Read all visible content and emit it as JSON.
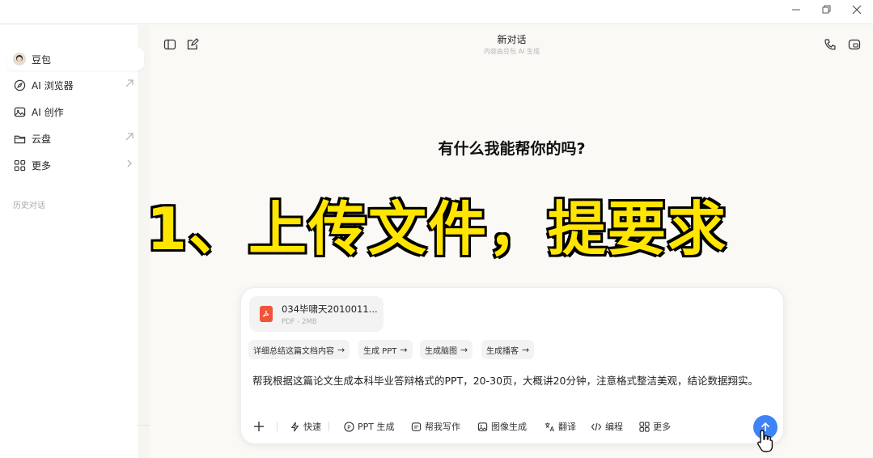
{
  "window": {
    "minimize_icon": "minimize-icon",
    "restore_icon": "restore-icon",
    "close_icon": "close-icon"
  },
  "sidebar": {
    "items": [
      {
        "label": "豆包",
        "icon": "avatar-icon"
      },
      {
        "label": "AI 浏览器",
        "icon": "compass-icon"
      },
      {
        "label": "AI 创作",
        "icon": "image-icon"
      },
      {
        "label": "云盘",
        "icon": "folder-icon"
      },
      {
        "label": "更多",
        "icon": "grid-icon"
      }
    ],
    "history_label": "历史对话"
  },
  "header": {
    "title": "新对话",
    "subtitle": "内容由豆包 AI 生成"
  },
  "main": {
    "greeting": "有什么我能帮你的吗?"
  },
  "overlay": {
    "caption": "1、上传文件，提要求"
  },
  "input": {
    "file": {
      "name": "034毕啸天2010011...",
      "meta": "PDF - 2MB",
      "icon_label": "PDF"
    },
    "suggestions": [
      {
        "label": "详细总结这篇文档内容"
      },
      {
        "label": "生成 PPT"
      },
      {
        "label": "生成脑图"
      },
      {
        "label": "生成播客"
      }
    ],
    "prompt": "帮我根据这篇论文生成本科毕业答辩格式的PPT，20-30页，大概讲20分钟，注意格式整洁美观，结论数据翔实。",
    "tools": [
      {
        "label": "快速"
      },
      {
        "label": "PPT 生成"
      },
      {
        "label": "帮我写作"
      },
      {
        "label": "图像生成"
      },
      {
        "label": "翻译"
      },
      {
        "label": "编程"
      },
      {
        "label": "更多"
      }
    ]
  },
  "colors": {
    "accent": "#3f83f8",
    "caption_fill": "#ffe500",
    "pdf_red": "#f0553a"
  }
}
